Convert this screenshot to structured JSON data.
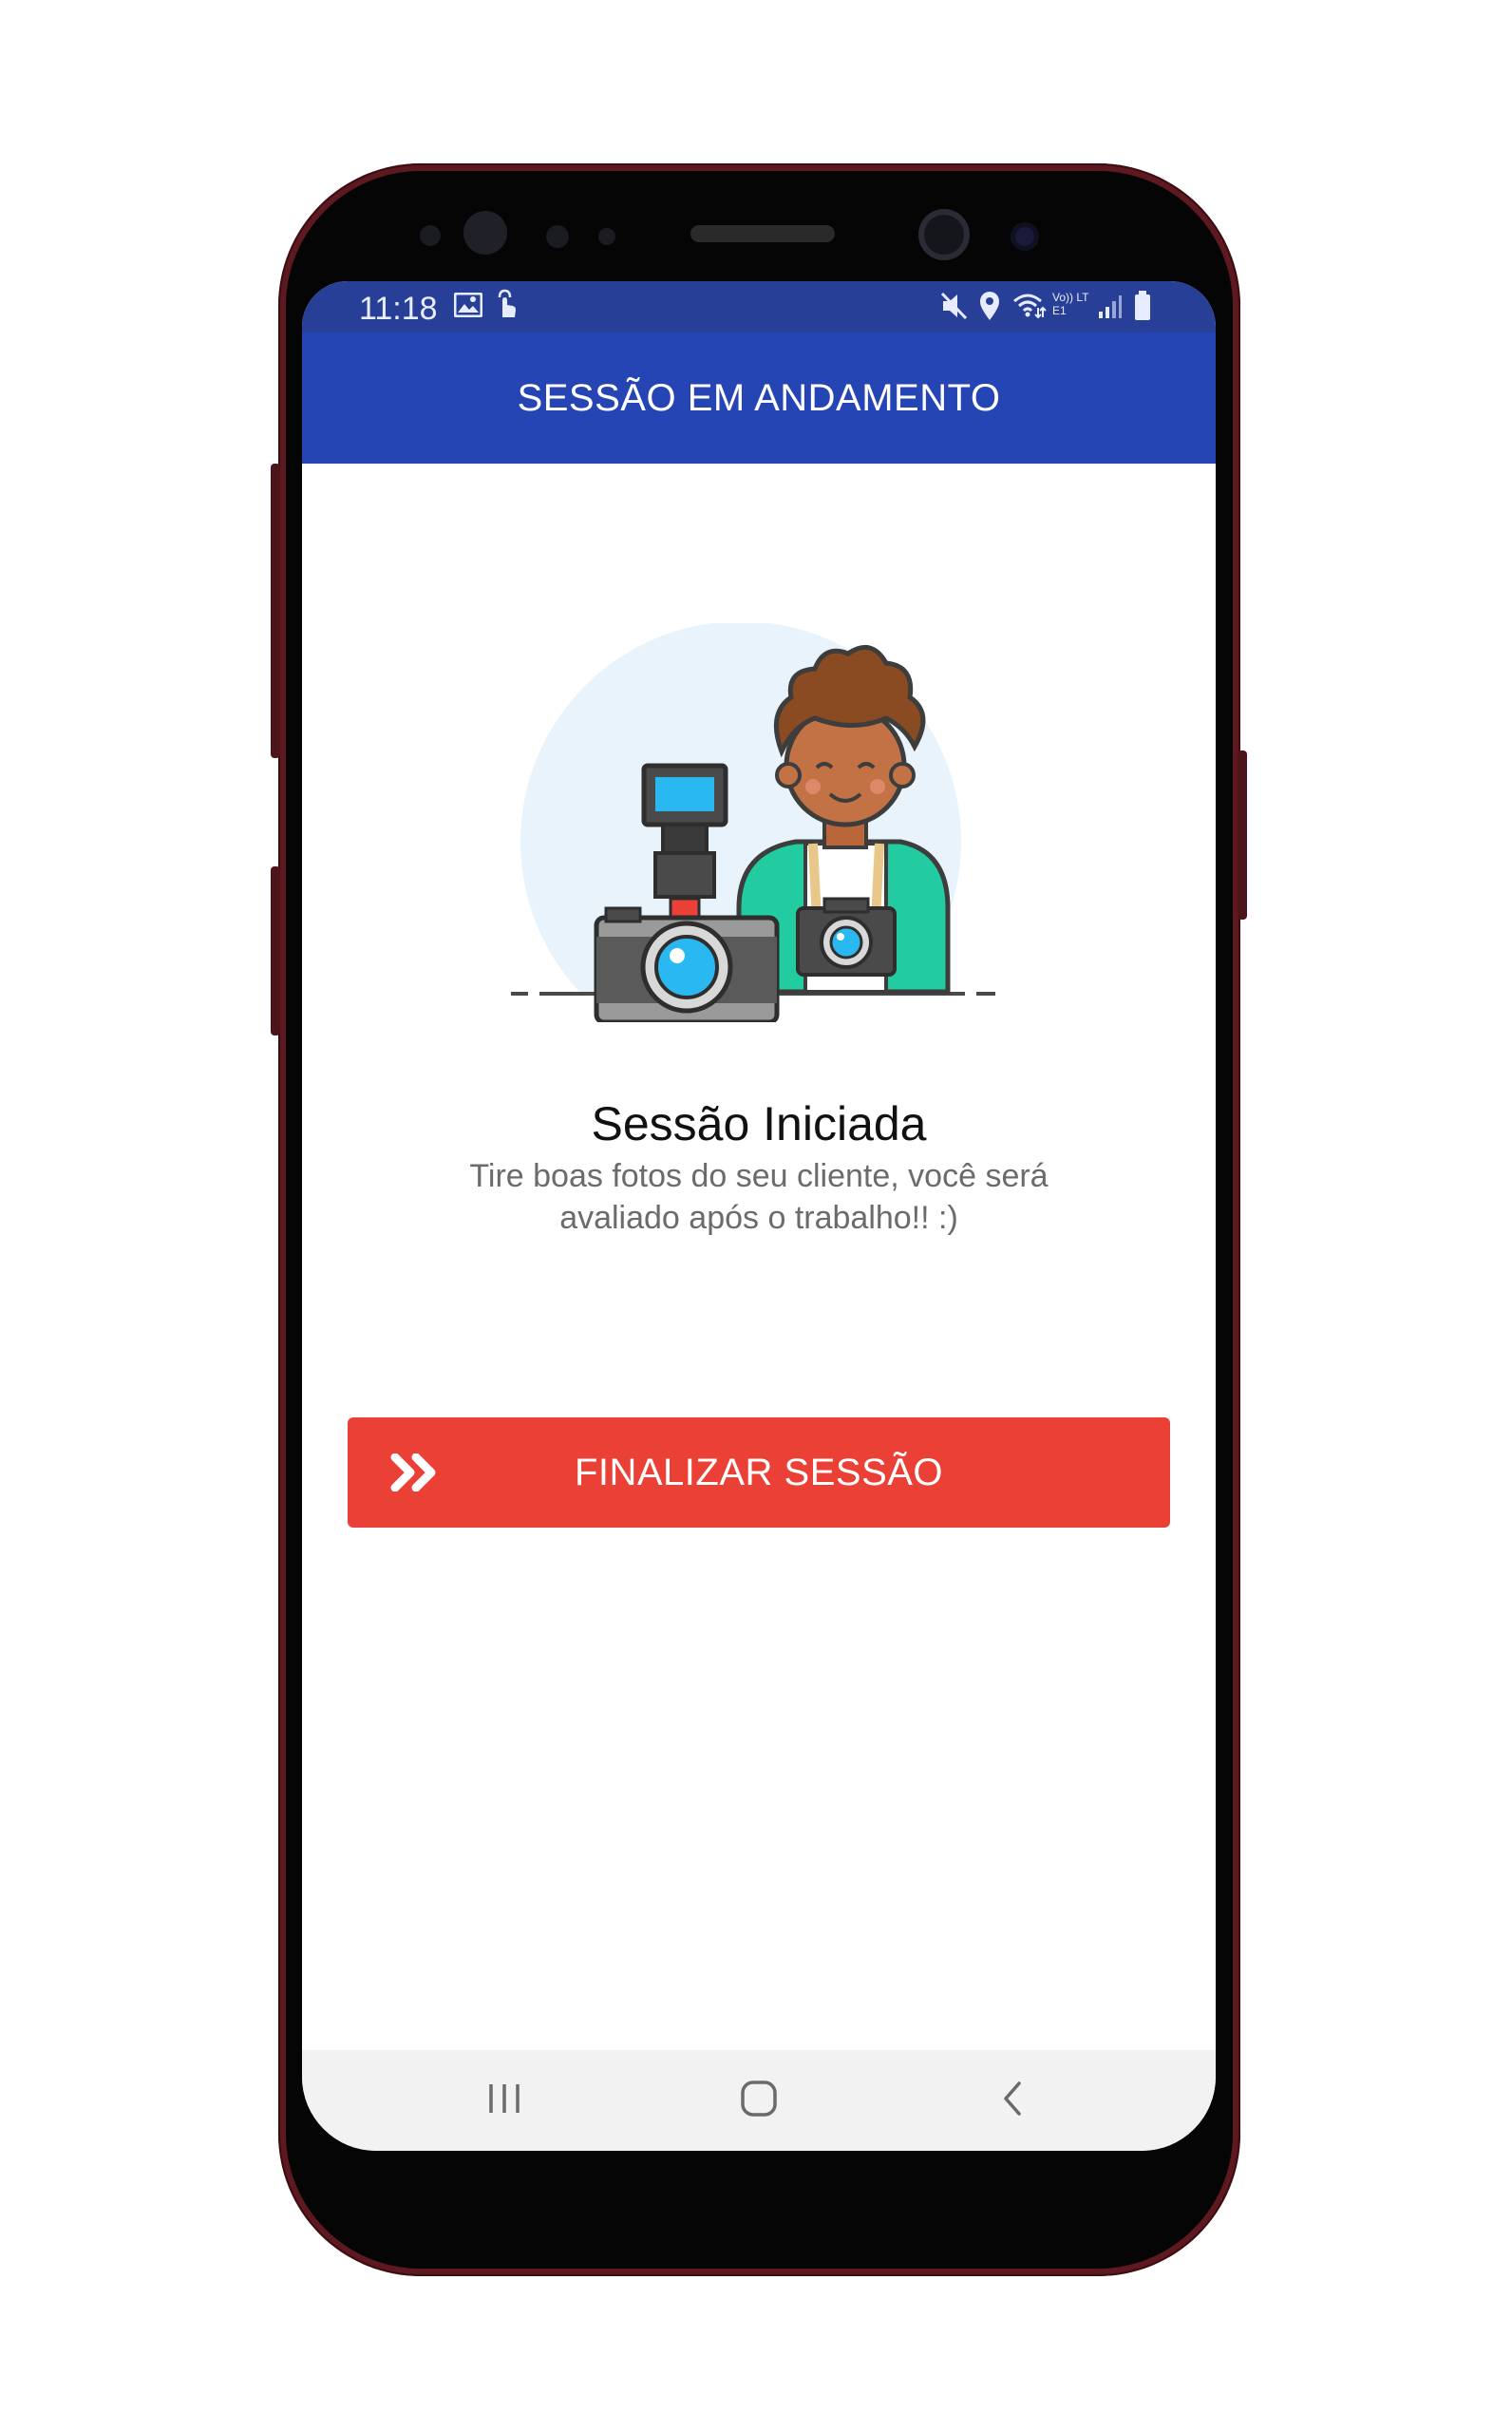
{
  "status_bar": {
    "time": "11:18",
    "left_icons": [
      "image-icon",
      "touch-icon"
    ],
    "right_icons": [
      "mute-icon",
      "location-icon",
      "wifi-icon",
      "volte-icon",
      "signal-icon",
      "battery-icon"
    ],
    "volte_label": "Vo)) LTE1"
  },
  "app_bar": {
    "title": "SESSÃO EM ANDAMENTO",
    "color": "#2645b4"
  },
  "main": {
    "illustration": "photographer-with-cameras",
    "headline": "Sessão Iniciada",
    "subtext": "Tire boas fotos do seu cliente, você será avaliado após o trabalho!! :)"
  },
  "finish_button": {
    "label": "FINALIZAR SESSÃO",
    "icon": "double-chevron-right-icon",
    "color": "#ea4035"
  },
  "nav_bar": {
    "buttons": [
      "recent-apps-icon",
      "home-icon",
      "back-icon"
    ]
  }
}
